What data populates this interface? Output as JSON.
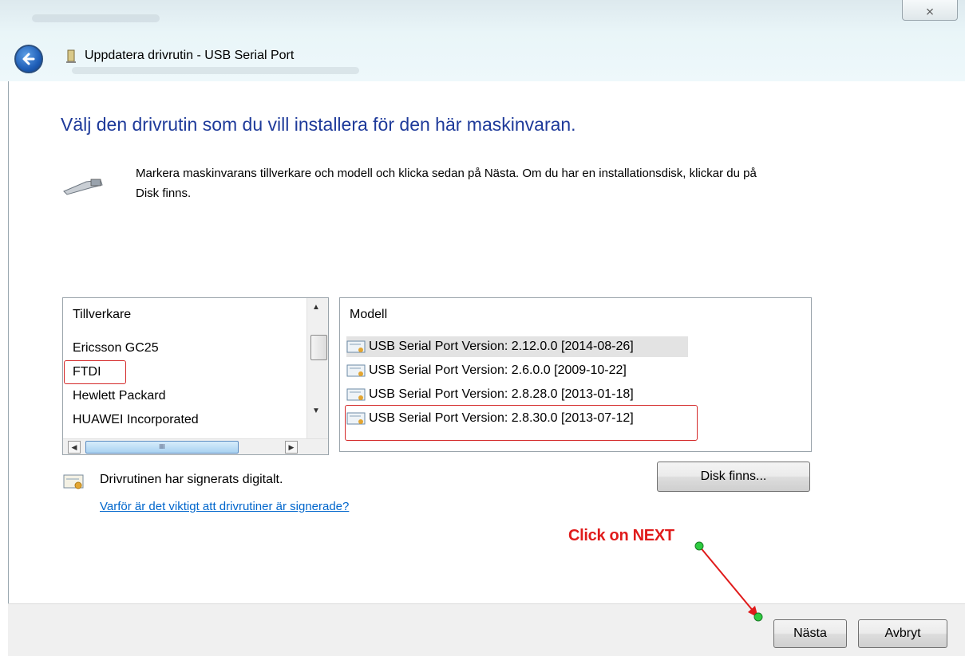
{
  "window": {
    "title": "Uppdatera drivrutin - USB Serial Port",
    "close_glyph": "⨯"
  },
  "main": {
    "heading": "Välj den drivrutin som du vill installera för den här maskinvaran.",
    "description": "Markera maskinvarans tillverkare och modell och klicka sedan på Nästa. Om du har en installationsdisk, klickar du på Disk finns."
  },
  "manufacturer_list": {
    "header": "Tillverkare",
    "items": [
      "Ericsson GC25",
      "FTDI",
      "Hewlett Packard",
      "HUAWEI Incorporated"
    ],
    "hscroll_grip": "III"
  },
  "model_list": {
    "header": "Modell",
    "items": [
      "USB Serial Port Version: 2.12.0.0 [2014-08-26]",
      "USB Serial Port Version: 2.6.0.0 [2009-10-22]",
      "USB Serial Port Version: 2.8.28.0 [2013-01-18]",
      "USB Serial Port Version: 2.8.30.0 [2013-07-12]"
    ]
  },
  "signature": {
    "text": "Drivrutinen har signerats digitalt.",
    "link": "Varför är det viktigt att drivrutiner är signerade?"
  },
  "buttons": {
    "disk": "Disk finns...",
    "next": "Nästa",
    "cancel": "Avbryt"
  },
  "annotation": {
    "text": "Click on NEXT",
    "color": "#e01b1b",
    "marker_color": "#2ecc40"
  }
}
